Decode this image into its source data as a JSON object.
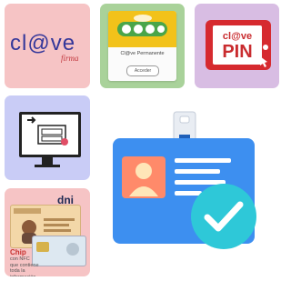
{
  "tiles": {
    "clave": {
      "logo_text": "cl@ve",
      "subtitle": "firma"
    },
    "permanente": {
      "title": "Cl@ve Permanente",
      "button_label": "Acceder"
    },
    "pin": {
      "brand": "cl@ve",
      "pin": "PIN"
    },
    "pc": {
      "icon": "computer-monitor-icon"
    },
    "dni": {
      "label": "dni",
      "chip_title": "Chip",
      "description": "con NFC\nque contiene\ntoda la información"
    }
  },
  "badge": {
    "icon": "id-card-with-checkmark-icon",
    "check_color": "#2ec8d8",
    "card_color": "#3d8ff0"
  },
  "colors": {
    "pink": "#f6c4c5",
    "green": "#a9d29a",
    "purple": "#d8bde3",
    "lavender": "#c9ccf6"
  }
}
